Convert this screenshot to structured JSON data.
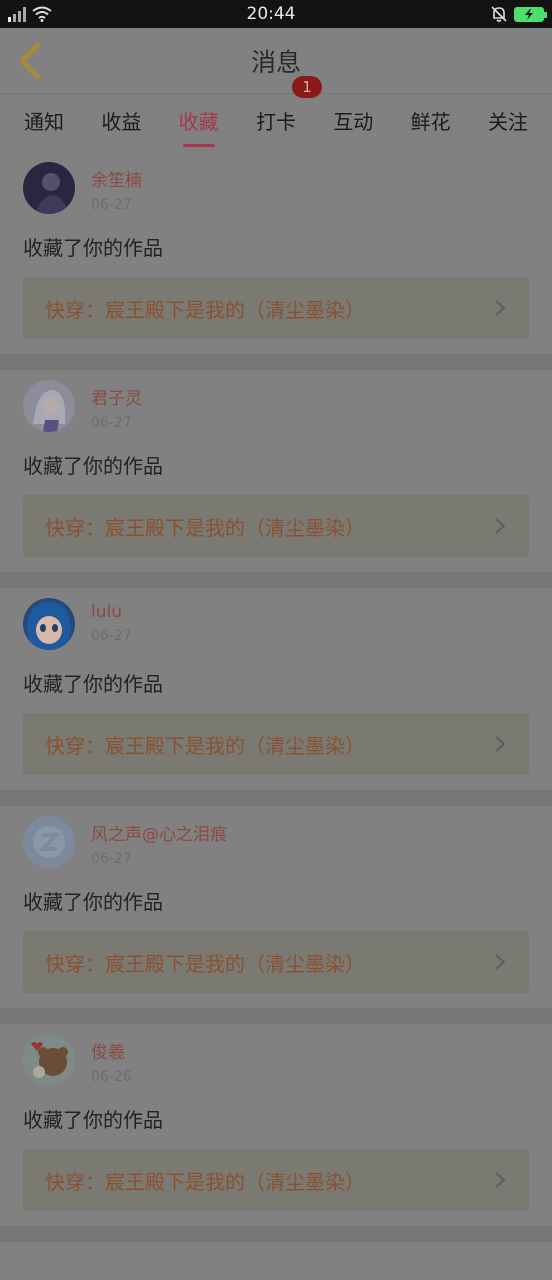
{
  "status_bar": {
    "time": "20:44"
  },
  "header": {
    "title": "消息"
  },
  "tabs": [
    {
      "label": "通知"
    },
    {
      "label": "收益"
    },
    {
      "label": "收藏"
    },
    {
      "label": "打卡",
      "badge": "1"
    },
    {
      "label": "互动"
    },
    {
      "label": "鲜花"
    },
    {
      "label": "关注"
    }
  ],
  "active_tab": "收藏",
  "colors": {
    "accent": "#a3384e",
    "username": "#8a4a43",
    "work_title": "#8a5131",
    "badge": "#8a1a1a"
  },
  "items": [
    {
      "username": "余笙楠",
      "date": "06-27",
      "action": "收藏了你的作品",
      "work": "快穿：宸王殿下是我的（清尘墨染）"
    },
    {
      "username": "君子灵",
      "date": "06-27",
      "action": "收藏了你的作品",
      "work": "快穿：宸王殿下是我的（清尘墨染）"
    },
    {
      "username": "lulu",
      "date": "06-27",
      "action": "收藏了你的作品",
      "work": "快穿：宸王殿下是我的（清尘墨染）"
    },
    {
      "username": "风之声@心之泪痕",
      "date": "06-27",
      "action": "收藏了你的作品",
      "work": "快穿：宸王殿下是我的（清尘墨染）"
    },
    {
      "username": "俊羲",
      "date": "06-26",
      "action": "收藏了你的作品",
      "work": "快穿：宸王殿下是我的（清尘墨染）"
    }
  ]
}
